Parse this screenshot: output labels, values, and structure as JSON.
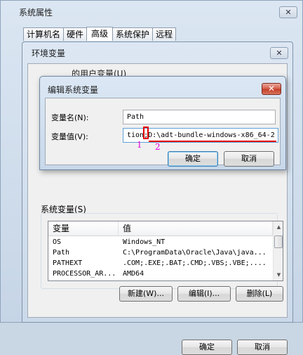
{
  "system_properties": {
    "title": "系统属性",
    "close_glyph": "✕",
    "tabs": [
      {
        "label": "计算机名"
      },
      {
        "label": "硬件"
      },
      {
        "label": "高级",
        "active": true
      },
      {
        "label": "系统保护"
      },
      {
        "label": "远程"
      }
    ]
  },
  "env_window": {
    "title": "环境变量",
    "close_glyph": "✕",
    "user_section_label": "的用户变量(U)",
    "system_vars": {
      "label": "系统变量(S)",
      "columns": [
        "变量",
        "值"
      ],
      "rows": [
        {
          "name": "OS",
          "value": "Windows_NT"
        },
        {
          "name": "Path",
          "value": "C:\\ProgramData\\Oracle\\Java\\java..."
        },
        {
          "name": "PATHEXT",
          "value": ".COM;.EXE;.BAT;.CMD;.VBS;.VBE;...."
        },
        {
          "name": "PROCESSOR_AR...",
          "value": "AMD64"
        }
      ],
      "buttons": {
        "new": "新建(W)...",
        "edit": "编辑(I)...",
        "delete": "删除(L)"
      }
    },
    "ok": "确定",
    "cancel": "取消"
  },
  "edit_dialog": {
    "title": "编辑系统变量",
    "close_glyph": "✕",
    "name_label": "变量名(N):",
    "name_value": "Path",
    "value_label": "变量值(V):",
    "value_text": "tion;D:\\adt-bundle-windows-x86_64-2",
    "ok": "确定",
    "cancel": "取消"
  },
  "annotations": {
    "marker_1": "1",
    "marker_2": "2",
    "accent_color": "#e60000",
    "number_color": "#e000e0"
  }
}
